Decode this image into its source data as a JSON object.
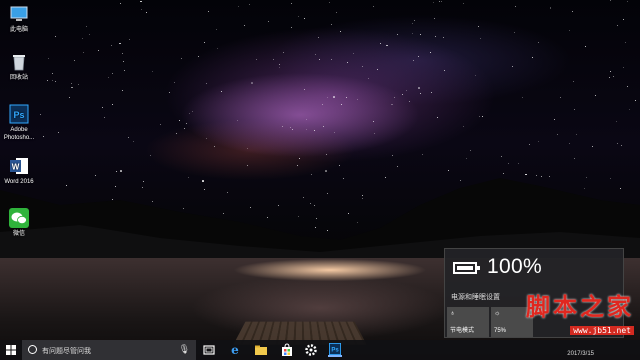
{
  "desktop": {
    "icons": [
      {
        "label": "此电脑",
        "icon": "computer-icon"
      },
      {
        "label": "回收站",
        "icon": "recycle-bin-icon"
      },
      {
        "label": "Adobe Photosho...",
        "icon": "photoshop-icon"
      },
      {
        "label": "Word 2016",
        "icon": "word-icon"
      },
      {
        "label": "微信",
        "icon": "wechat-icon"
      }
    ]
  },
  "battery_flyout": {
    "percent_text": "100%",
    "level": 1.0,
    "settings_link": "电源和睡眠设置",
    "tiles": [
      {
        "label": "节电模式",
        "icon": "battery-saver-icon"
      },
      {
        "label": "75%",
        "icon": "brightness-icon"
      }
    ]
  },
  "taskbar": {
    "search_placeholder": "有问题尽管问我",
    "date": "2017/3/15",
    "pinned": [
      {
        "name": "task-view-icon"
      },
      {
        "name": "edge-icon"
      },
      {
        "name": "file-explorer-icon"
      },
      {
        "name": "store-icon"
      },
      {
        "name": "settings-icon"
      },
      {
        "name": "photoshop-icon"
      }
    ]
  },
  "watermark": {
    "title": "脚本之家",
    "url": "www.jb51.net"
  },
  "colors": {
    "accent": "#7fb3ff",
    "photoshop": "#0b2f57",
    "word": "#2b5797",
    "wechat": "#2fb33b",
    "watermark": "#e0271f"
  }
}
